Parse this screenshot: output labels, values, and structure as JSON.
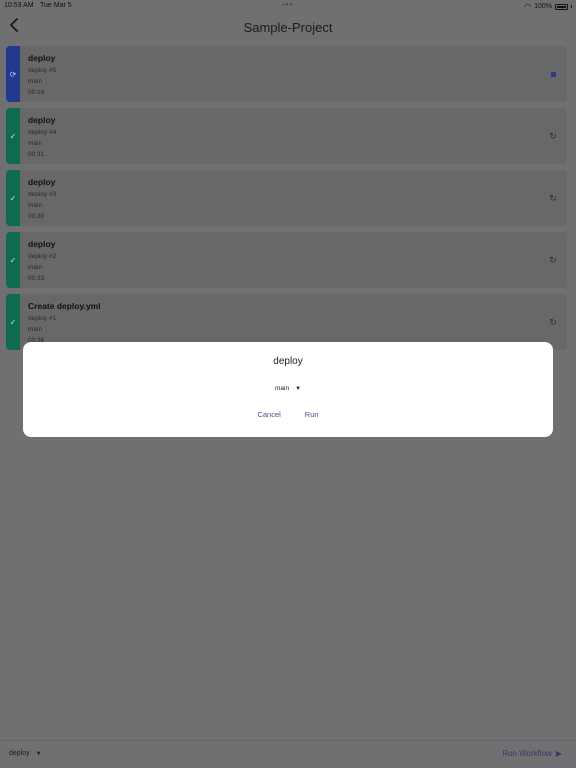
{
  "status": {
    "time": "10:53 AM",
    "date": "Tue Mar 5",
    "battery": "100%"
  },
  "header": {
    "title": "Sample-Project"
  },
  "runs": [
    {
      "title": "deploy",
      "run_label": "deploy #5",
      "branch": "main",
      "duration": "00:18",
      "status": "running",
      "action": "stop"
    },
    {
      "title": "deploy",
      "run_label": "deploy #4",
      "branch": "main",
      "duration": "00:31",
      "status": "success",
      "action": "rerun"
    },
    {
      "title": "deploy",
      "run_label": "deploy #3",
      "branch": "main",
      "duration": "00:36",
      "status": "success",
      "action": "rerun"
    },
    {
      "title": "deploy",
      "run_label": "deploy #2",
      "branch": "main",
      "duration": "00:33",
      "status": "success",
      "action": "rerun"
    },
    {
      "title": "Create deploy.yml",
      "run_label": "deploy #1",
      "branch": "main",
      "duration": "00:36",
      "status": "success",
      "action": "rerun"
    }
  ],
  "bottom_bar": {
    "workflow": "deploy",
    "run_workflow": "Run Workflow"
  },
  "dialog": {
    "title": "deploy",
    "branch": "main",
    "cancel": "Cancel",
    "run": "Run"
  },
  "colors": {
    "running": "#21398f",
    "success": "#0f6b50",
    "accent": "#4a4f8a"
  }
}
